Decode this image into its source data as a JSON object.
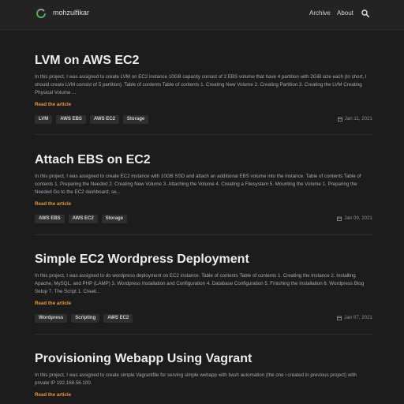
{
  "header": {
    "site_name": "mohzulfikar",
    "nav": [
      "Archive",
      "About"
    ],
    "icons": {
      "logo": "ring-logo-icon",
      "search": "search-icon"
    }
  },
  "posts": [
    {
      "title": "LVM on AWS EC2",
      "summary": "In this project, I was assigned to create LVM on EC2 instance 10GB capacity consist of 2 EBS volume that have 4 partition with 2GiB size each (In short, I should create LVM consist of 5 partition). Table of contents Table of contents 1. Creating New Volume 2. Creating Partition 3. Creating the LVM Creating Physical Volume ...",
      "read_more": "Read the article",
      "tags": [
        "LVM",
        "AWS EBS",
        "AWS EC2",
        "Storage"
      ],
      "date": "Jan 11, 2021"
    },
    {
      "title": "Attach EBS on EC2",
      "summary": "In this project, I was assigned to create EC2 instance with 10GB SSD and attach an additional EBS volume into the instance. Table of contents Table of contents 1. Preparing the Needed 2. Creating New Volume 3. Attaching the Volume 4. Creating a Filesystem 5. Mounting the Volume 1. Preparing the Needed Go to the EC2 dashboard, se...",
      "read_more": "Read the article",
      "tags": [
        "AWS EBS",
        "AWS EC2",
        "Storage"
      ],
      "date": "Jan 09, 2021"
    },
    {
      "title": "Simple EC2 Wordpress Deployment",
      "summary": "In this project, I was assigned to do wordpress deployment on EC2 instance. Table of contents Table of contents 1. Creating the Instance 2. Installing Apache, MySQL, and PHP (LAMP) 3. Wordpress Installation and Configuration 4. Database Configuration 5. Finishing the Installation 6. Wordpress Blog Setup 7. The Script 1. Creati...",
      "read_more": "Read the article",
      "tags": [
        "Wordpress",
        "Scripting",
        "AWS EC2"
      ],
      "date": "Jan 07, 2021"
    },
    {
      "title": "Provisioning Webapp Using Vagrant",
      "summary": "In this project, I was assigned to create simple Vagrantfile for serving simple webapp with bash automation (the one i created in previous project) with private IP 192.168.56.100.",
      "read_more": "Read the article",
      "tags": [],
      "date": ""
    }
  ],
  "colors": {
    "accent": "#e69a2c",
    "background": "#1c1c1c",
    "header": "#232323"
  }
}
